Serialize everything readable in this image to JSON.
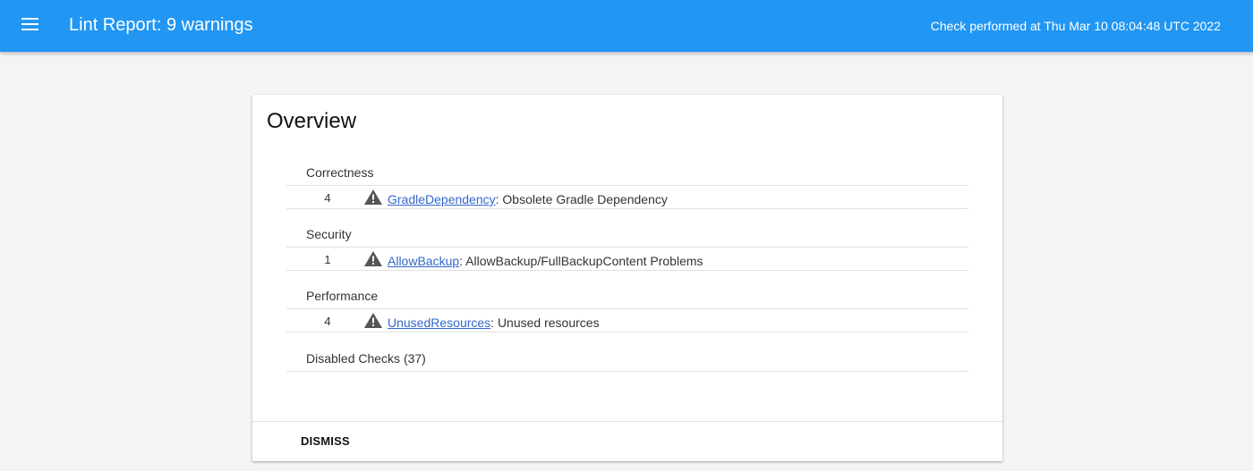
{
  "header": {
    "title": "Lint Report: 9 warnings",
    "meta": "Check performed at Thu Mar 10 08:04:48 UTC 2022",
    "menu_icon": "hamburger-menu-icon",
    "background_color": "#2196f3"
  },
  "overview": {
    "title": "Overview",
    "categories": [
      {
        "name": "Correctness",
        "issues": [
          {
            "count": "4",
            "icon": "warning-icon",
            "id": "GradleDependency",
            "description": ": Obsolete Gradle Dependency"
          }
        ]
      },
      {
        "name": "Security",
        "issues": [
          {
            "count": "1",
            "icon": "warning-icon",
            "id": "AllowBackup",
            "description": ": AllowBackup/FullBackupContent Problems"
          }
        ]
      },
      {
        "name": "Performance",
        "issues": [
          {
            "count": "4",
            "icon": "warning-icon",
            "id": "UnusedResources",
            "description": ": Unused resources"
          }
        ]
      }
    ],
    "disabled_checks": "Disabled Checks (37)"
  },
  "actions": {
    "dismiss_label": "DISMISS"
  }
}
